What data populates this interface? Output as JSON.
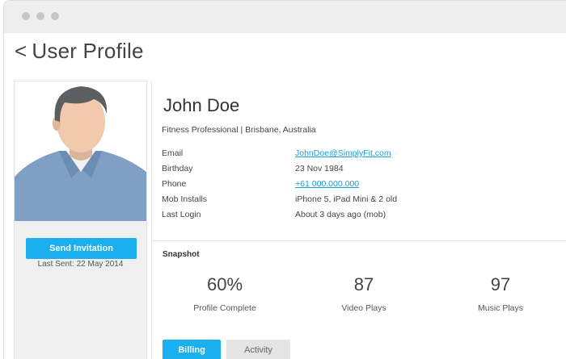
{
  "page": {
    "title": "User Profile"
  },
  "profile": {
    "name": "John Doe",
    "headline": "Fitness Professional | Brisbane, Australia",
    "details": [
      {
        "label": "Email",
        "value": "JohnDoe@SimplyFit.com"
      },
      {
        "label": "Birthday",
        "value": "23 Nov 1984"
      },
      {
        "label": "Phone",
        "value": "+61 000.000.000"
      },
      {
        "label": "Mob Installs",
        "value": "iPhone 5, iPad Mini & 2 old"
      },
      {
        "label": "Last Login",
        "value": "About 3 days ago (mob)"
      }
    ]
  },
  "sidebar": {
    "send_invitation_label": "Send Invitation",
    "last_sent_label": "Last Sent:",
    "last_sent_date": "22 May 2014"
  },
  "snapshot": {
    "title": "Snapshot",
    "stats": [
      {
        "value": "60%",
        "label": "Profile Complete"
      },
      {
        "value": "87",
        "label": "Video Plays"
      },
      {
        "value": "97",
        "label": "Music Plays"
      }
    ]
  },
  "tabs": [
    {
      "label": "Billing",
      "active": true
    },
    {
      "label": "Activity",
      "active": false
    }
  ],
  "colors": {
    "accent": "#1ab0ef",
    "link": "#1a9ee0",
    "panel_bg": "#f0f0f0",
    "titlebar_bg": "#eeeeee"
  },
  "icons": {
    "back": "chevron-left-icon",
    "window_controls": [
      "window-dot-icon",
      "window-dot-icon",
      "window-dot-icon"
    ]
  }
}
